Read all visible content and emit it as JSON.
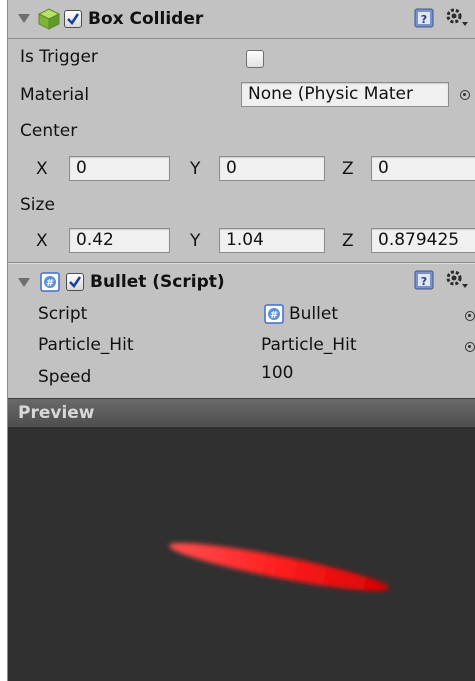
{
  "box_collider": {
    "title": "Box Collider",
    "enabled": true,
    "is_trigger_label": "Is Trigger",
    "is_trigger": false,
    "material_label": "Material",
    "material_value": "None (Physic Mater",
    "center_label": "Center",
    "center": {
      "x_label": "X",
      "x": "0",
      "y_label": "Y",
      "y": "0",
      "z_label": "Z",
      "z": "0"
    },
    "size_label": "Size",
    "size": {
      "x_label": "X",
      "x": "0.42",
      "y_label": "Y",
      "y": "1.04",
      "z_label": "Z",
      "z": "0.879425"
    }
  },
  "bullet_script": {
    "title": "Bullet (Script)",
    "enabled": true,
    "fields": [
      {
        "label": "Script",
        "value": "Bullet"
      },
      {
        "label": "Particle_Hit",
        "value": "Particle_Hit"
      },
      {
        "label": "Speed",
        "value": "100"
      }
    ]
  },
  "preview": {
    "title": "Preview"
  },
  "colors": {
    "panel_bg": "#c2c2c2",
    "field_bg": "#f0f0f0",
    "preview_bg": "#303030",
    "bullet_red": "#ff2a2a",
    "collider_green": "#8fcf3a",
    "script_blue": "#2f6fd6"
  },
  "icons": {
    "foldout": "triangle-down-icon",
    "collider": "cube-icon",
    "script": "csharp-script-icon",
    "help": "help-book-icon",
    "settings": "gear-icon",
    "object_picker": "object-picker-icon"
  }
}
